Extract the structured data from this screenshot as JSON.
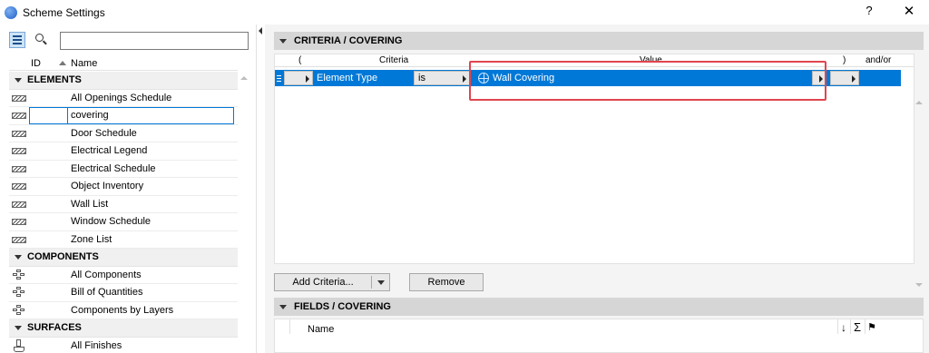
{
  "window": {
    "title": "Scheme Settings",
    "help_label": "?",
    "close_label": "✕"
  },
  "left": {
    "search": {
      "value": "",
      "placeholder": ""
    },
    "columns": {
      "id": "ID",
      "name": "Name"
    },
    "groups": [
      {
        "label": "ELEMENTS",
        "items": [
          "All Openings Schedule",
          "covering",
          "Door Schedule",
          "Electrical Legend",
          "Electrical Schedule",
          "Object Inventory",
          "Wall List",
          "Window Schedule",
          "Zone List"
        ]
      },
      {
        "label": "COMPONENTS",
        "items": [
          "All Components",
          "Bill of Quantities",
          "Components by Layers"
        ]
      },
      {
        "label": "SURFACES",
        "items": [
          "All Finishes"
        ]
      }
    ]
  },
  "criteria": {
    "title": "CRITERIA /  COVERING",
    "columns": {
      "open_paren": "(",
      "criteria": "Criteria",
      "value": "Value",
      "close_paren": ")",
      "andor": "and/or"
    },
    "row": {
      "criteria": "Element Type",
      "operator": "is",
      "value": "Wall Covering"
    },
    "add_button": "Add Criteria...",
    "remove_button": "Remove"
  },
  "fields": {
    "title": "FIELDS /  COVERING",
    "name_header": "Name",
    "sort_symbol": "↓",
    "sum_symbol": "Σ",
    "flag_symbol": "⚑"
  },
  "colors": {
    "selection": "#0078d7",
    "highlight": "#e0454e",
    "section_header": "#d6d6d6"
  }
}
